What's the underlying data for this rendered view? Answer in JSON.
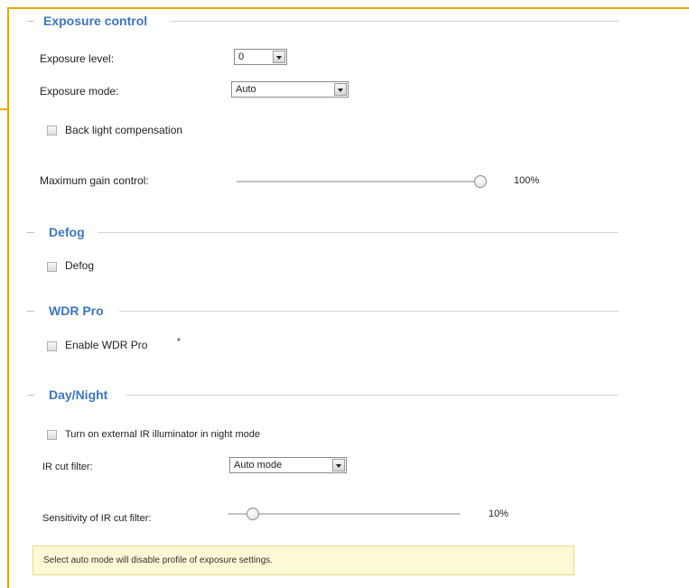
{
  "exposure": {
    "title": "Exposure control",
    "level_label": "Exposure level:",
    "level_value": "0",
    "mode_label": "Exposure mode:",
    "mode_value": "Auto",
    "backlight_label": "Back light compensation",
    "backlight_checked": false,
    "gain_label": "Maximum gain control:",
    "gain_value": 100,
    "gain_text": "100%"
  },
  "defog": {
    "title": "Defog",
    "checkbox_label": "Defog",
    "checked": false
  },
  "wdr": {
    "title": "WDR Pro",
    "checkbox_label": "Enable WDR Pro",
    "asterisk": "*",
    "checked": false
  },
  "daynight": {
    "title": "Day/Night",
    "ir_illuminator_label": "Turn on external IR illuminator in night mode",
    "ir_illuminator_checked": false,
    "ir_cut_label": "IR cut filter:",
    "ir_cut_value": "Auto mode",
    "sensitivity_label": "Sensitivity of IR cut filter:",
    "sensitivity_value": 10,
    "sensitivity_text": "10%"
  },
  "notice": {
    "text": "Select auto mode will disable profile of exposure settings."
  },
  "colors": {
    "frame": "#e8a800",
    "section_title": "#3c76c0",
    "notice_bg": "#fdf9d4"
  }
}
